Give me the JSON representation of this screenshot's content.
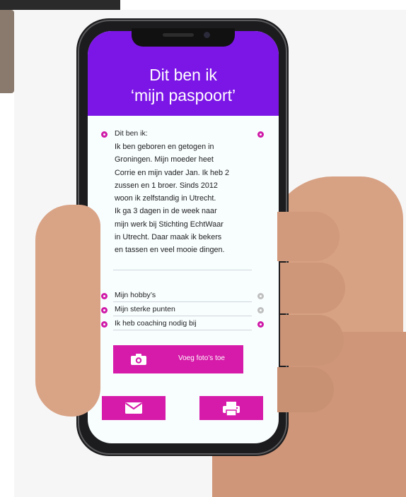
{
  "header": {
    "title_line1": "Dit ben ik",
    "title_line2": "‘mijn paspoort’"
  },
  "about": {
    "title": "Dit ben ik:",
    "lines": [
      "Ik ben geboren en getogen in",
      "Groningen. Mijn moeder heet",
      "Corrie en mijn vader Jan. Ik heb 2",
      "zussen en 1 broer. Sinds 2012",
      "woon ik zelfstandig in Utrecht.",
      "Ik ga 3 dagen in de week naar",
      "mijn werk bij Stichting EchtWaar",
      "in Utrecht. Daar maak ik bekers",
      "en tassen en veel mooie dingen."
    ]
  },
  "items": [
    {
      "label": "Mijn hobby’s"
    },
    {
      "label": "Mijn sterke punten"
    },
    {
      "label": "Ik heb coaching nodig bij"
    }
  ],
  "actions": {
    "add_photo_label": "Voeg foto’s toe"
  },
  "icons": {
    "camera": "camera-icon",
    "mail": "mail-icon",
    "print": "printer-icon"
  },
  "colors": {
    "header_bg": "#7b16e6",
    "accent": "#d61aa9",
    "screen_bg": "#f8fdfe"
  }
}
